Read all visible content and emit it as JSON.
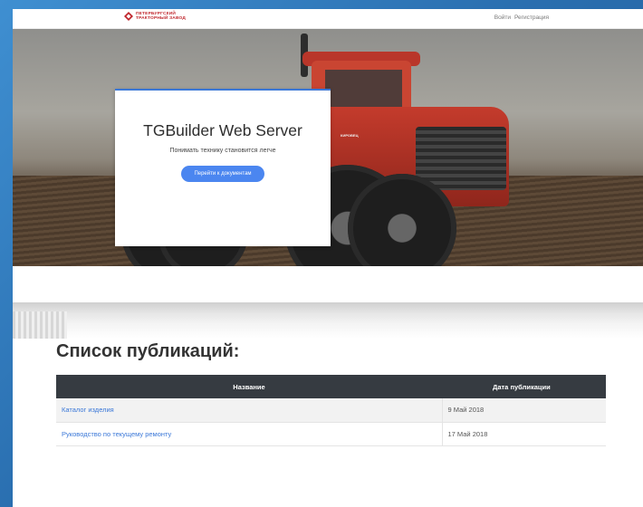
{
  "brand": {
    "line1": "ПЕТЕРБУРГСКИЙ",
    "line2": "ТРАКТОРНЫЙ ЗАВОД",
    "color": "#c0272d"
  },
  "nav": {
    "login": "Войти",
    "register": "Регистрация"
  },
  "hero": {
    "title": "TGBuilder Web Server",
    "subtitle": "Понимать технику становится легче",
    "button": "Перейти к документам",
    "tractor_badge": "КИРОВЕЦ"
  },
  "publications": {
    "title": "Список публикаций:",
    "columns": [
      "Название",
      "Дата публикации"
    ],
    "rows": [
      {
        "name": "Каталог изделия",
        "date": "9 Май 2018"
      },
      {
        "name": "Руководство по текущему ремонту",
        "date": "17 Май 2018"
      }
    ]
  },
  "colors": {
    "accent": "#4b86f0",
    "table_header": "#363b41",
    "link": "#3b78d8"
  }
}
